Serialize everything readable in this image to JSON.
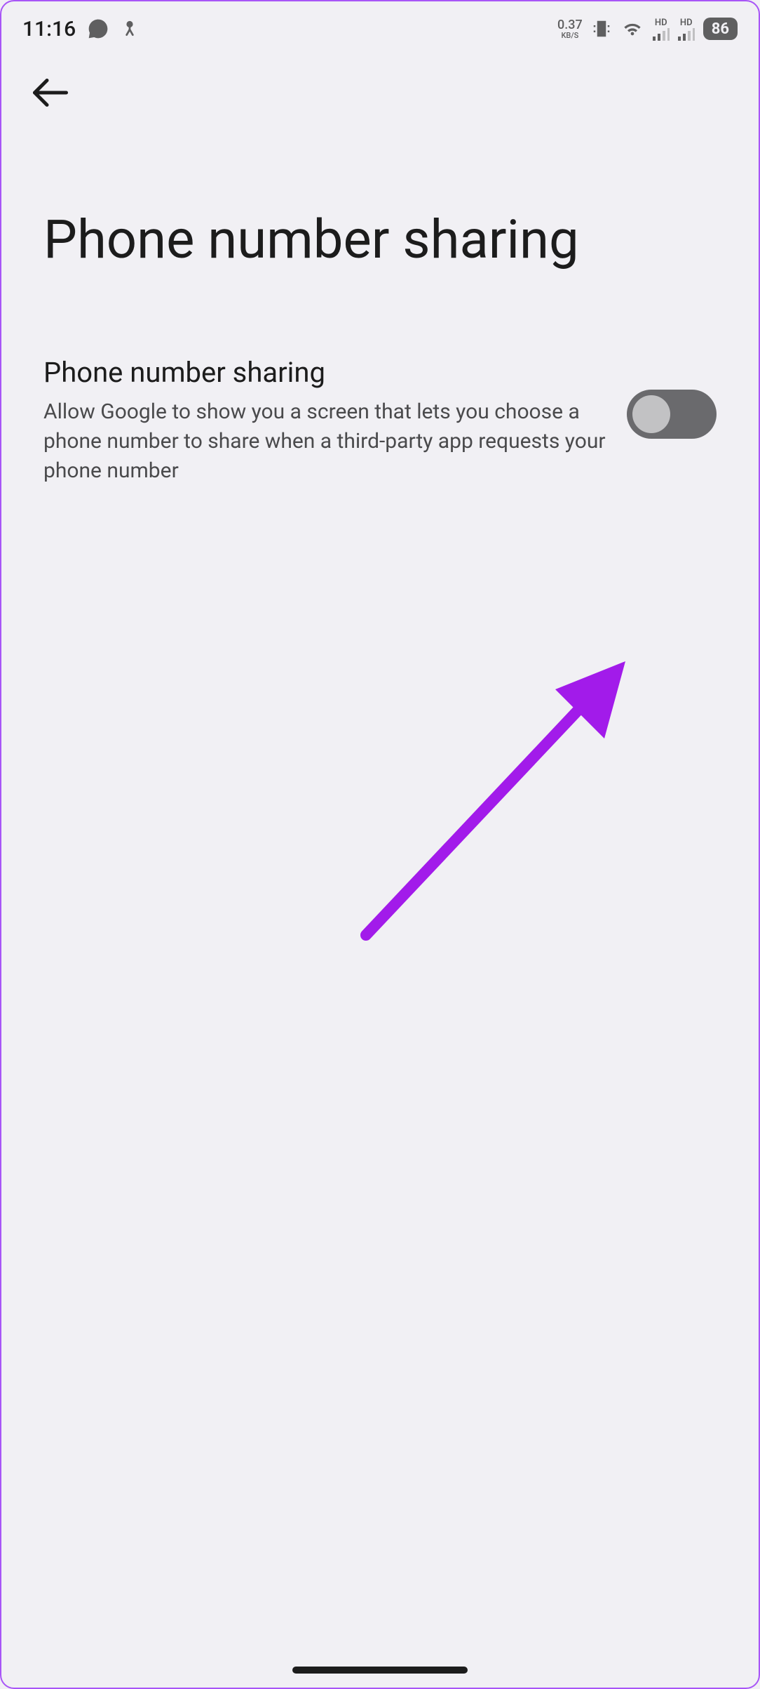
{
  "status_bar": {
    "time": "11:16",
    "data_rate_value": "0.37",
    "data_rate_unit": "KB/S",
    "signal_hd1": "HD",
    "signal_hd2": "HD",
    "battery_level": "86"
  },
  "header": {
    "title": "Phone number sharing"
  },
  "setting": {
    "title": "Phone number sharing",
    "description": "Allow Google to show you a screen that lets you choose a phone number to share when a third-party app requests your phone number",
    "toggle_state": false
  }
}
